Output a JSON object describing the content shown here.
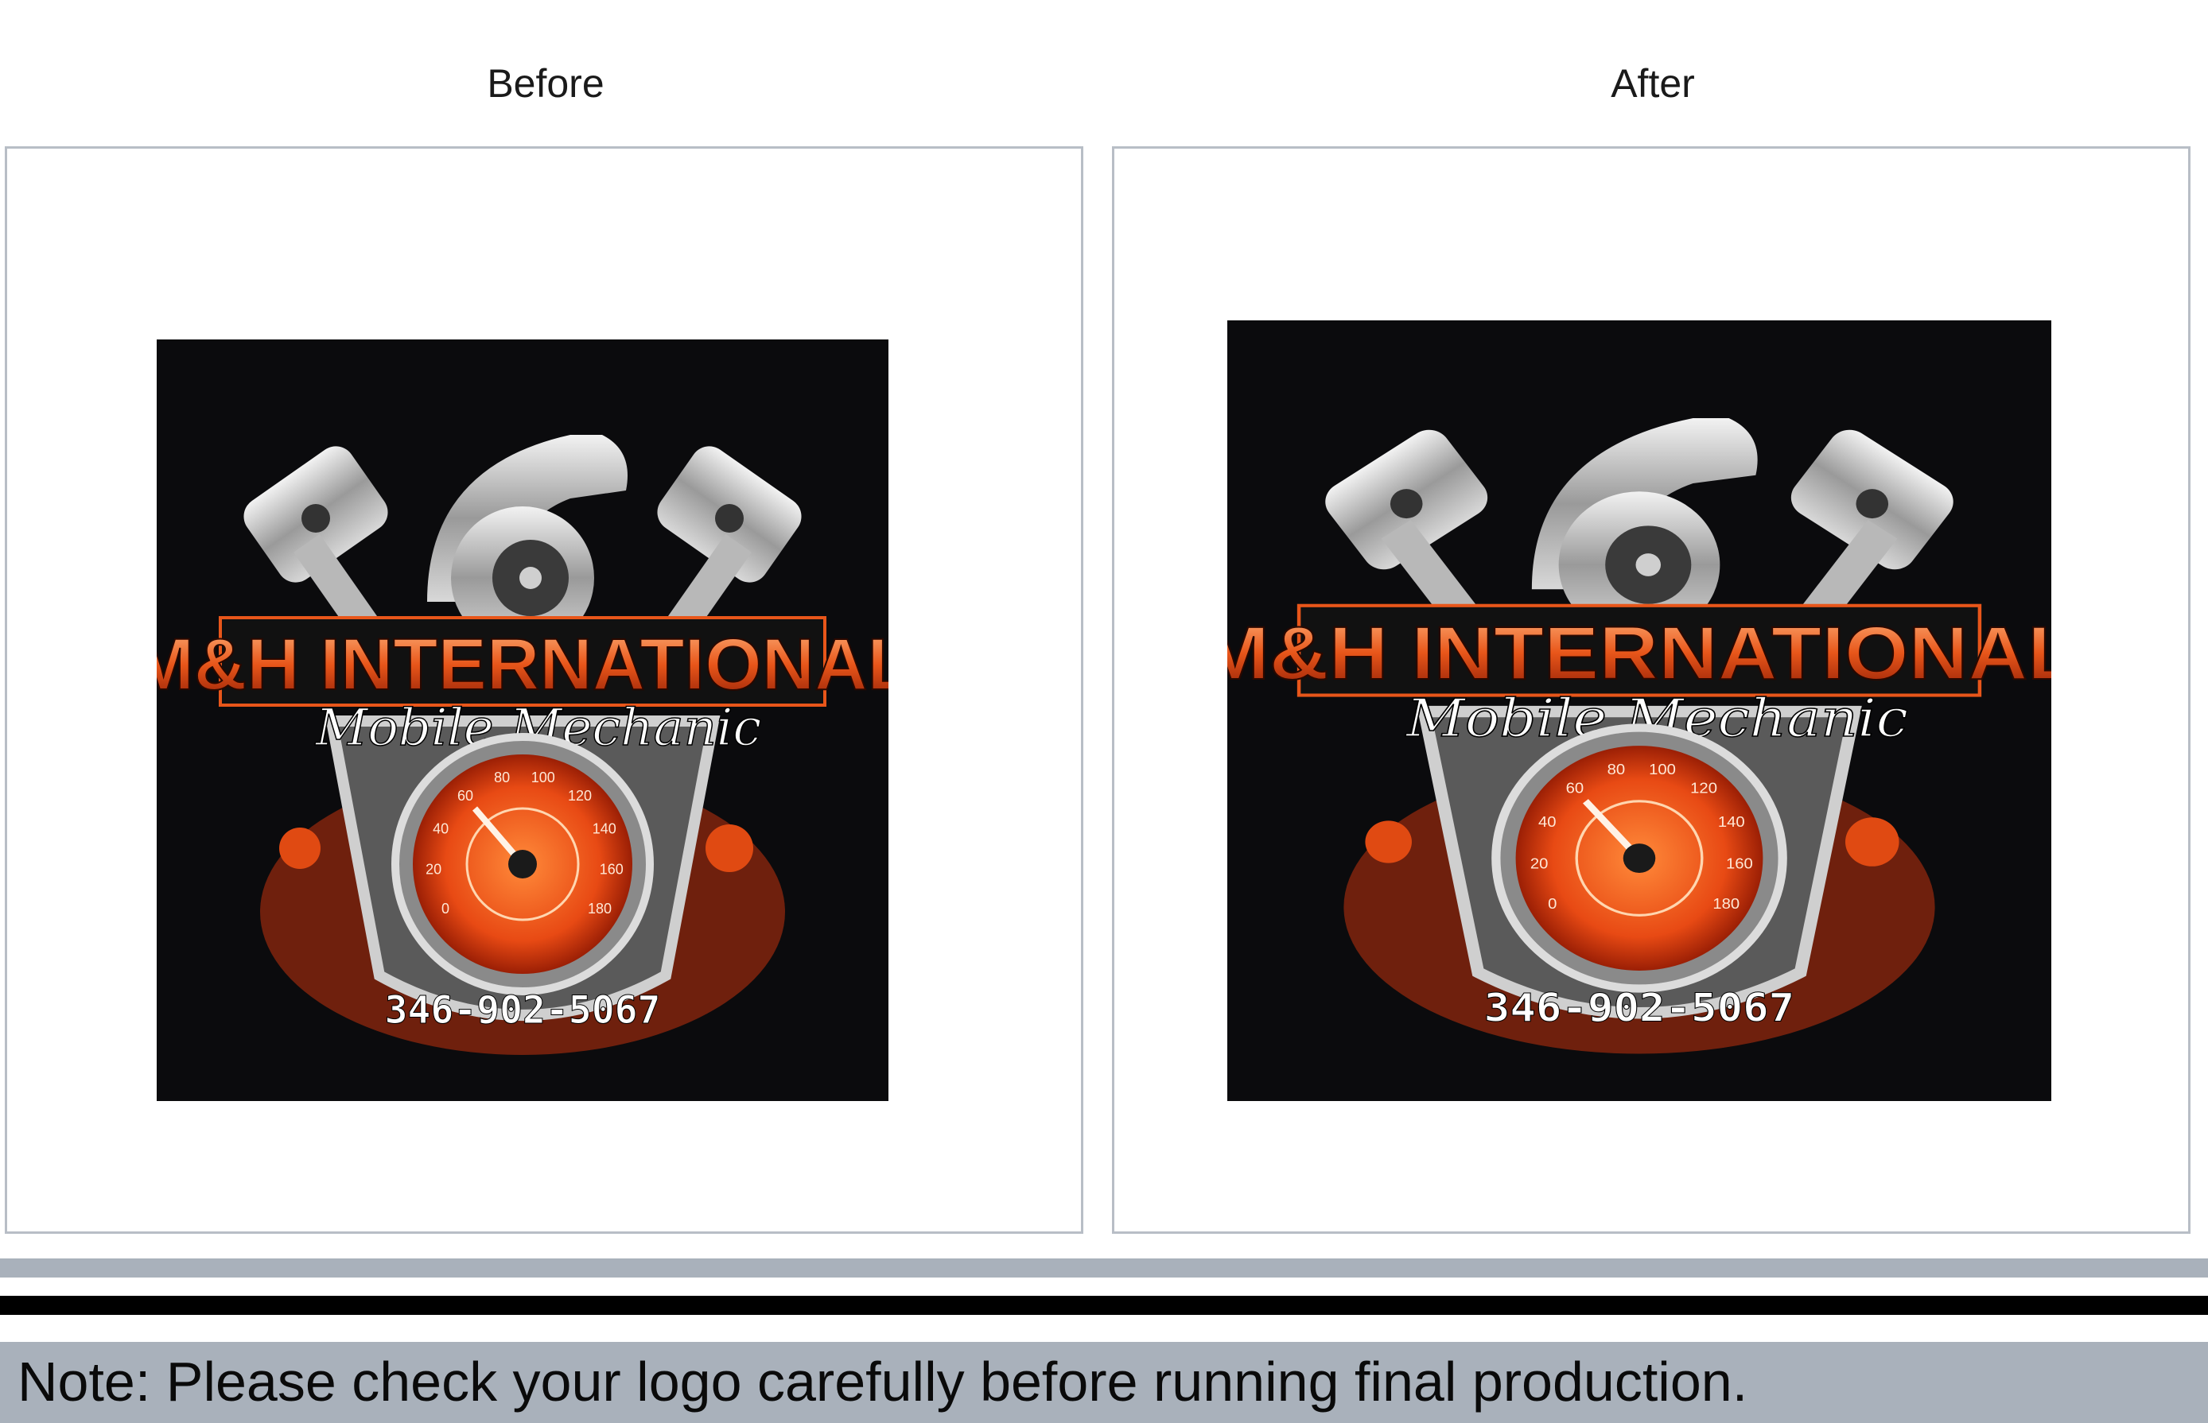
{
  "panels": {
    "before": {
      "title": "Before"
    },
    "after": {
      "title": "After"
    }
  },
  "logo": {
    "company": "M&H INTERNATIONAL",
    "tagline": "Mobile Mechanic",
    "phone": "346-902-5067",
    "gauge_ticks": [
      "180",
      "160",
      "140",
      "120",
      "100",
      "80",
      "60",
      "40",
      "20",
      "0"
    ]
  },
  "note": "Note: Please check your logo carefully before running final production.",
  "colors": {
    "accent_orange": "#e8561a",
    "panel_border": "#b8bec6",
    "bar_grey": "#a9b1bb",
    "logo_background": "#0b0b0d"
  }
}
